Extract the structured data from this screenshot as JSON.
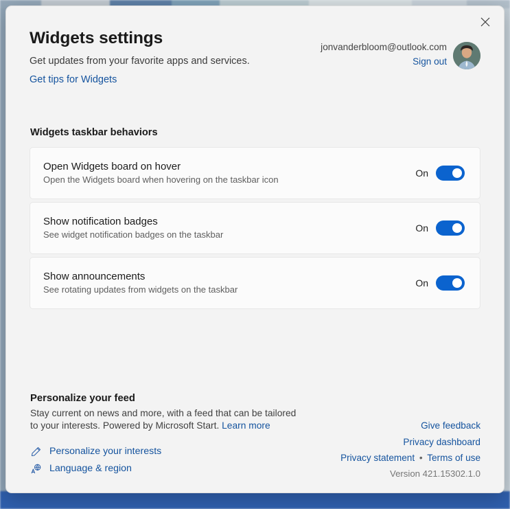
{
  "dialog": {
    "close_label": "Close",
    "close_icon": "close-icon"
  },
  "header": {
    "title": "Widgets settings",
    "subtitle": "Get updates from your favorite apps and services.",
    "tips_link": "Get tips for Widgets",
    "account": {
      "email": "jonvanderbloom@outlook.com",
      "signout_label": "Sign out",
      "avatar_icon": "avatar"
    }
  },
  "section": {
    "title": "Widgets taskbar behaviors",
    "rows": [
      {
        "title": "Open Widgets board on hover",
        "description": "Open the Widgets board when hovering on the taskbar icon",
        "state_label": "On",
        "state": "on"
      },
      {
        "title": "Show notification badges",
        "description": "See widget notification badges on the taskbar",
        "state_label": "On",
        "state": "on"
      },
      {
        "title": "Show announcements",
        "description": "See rotating updates from widgets on the taskbar",
        "state_label": "On",
        "state": "on"
      }
    ]
  },
  "feed": {
    "title": "Personalize your feed",
    "description": "Stay current on news and more, with a feed that can be tailored to your interests. Powered by Microsoft Start.",
    "learn_more": "Learn more",
    "links": [
      {
        "label": "Personalize your interests",
        "icon": "pencil-icon"
      },
      {
        "label": "Language & region",
        "icon": "language-icon"
      }
    ]
  },
  "legal": {
    "give_feedback": "Give feedback",
    "privacy_dashboard": "Privacy dashboard",
    "privacy_statement": "Privacy statement",
    "separator": "•",
    "terms_of_use": "Terms of use",
    "version": "Version 421.15302.1.0"
  },
  "colors": {
    "accent": "#0b63ce",
    "link": "#14539e",
    "dialog_bg": "#f3f3f3",
    "card_bg": "#fbfbfb"
  }
}
